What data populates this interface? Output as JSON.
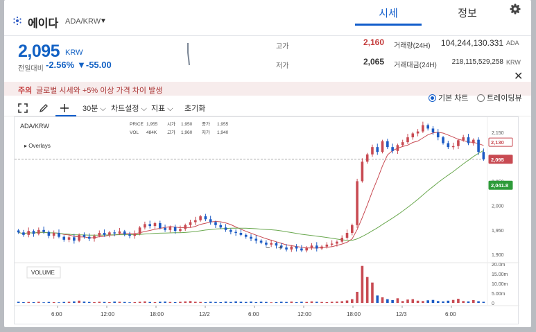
{
  "header": {
    "coin_name": "에이다",
    "pair": "ADA/KRW",
    "tabs": [
      {
        "label": "시세",
        "active": true
      },
      {
        "label": "정보",
        "active": false
      }
    ]
  },
  "price": {
    "current": "2,095",
    "unit": "KRW",
    "change_label": "전일대비",
    "change_rate": "-2.56%",
    "change_amount": "▼-55.00"
  },
  "stats": {
    "high_label": "고가",
    "high": "2,160",
    "low_label": "저가",
    "low": "2,065",
    "volume_label": "거래량(24H)",
    "volume": "104,244,130.331",
    "volume_unit": "ADA",
    "value_label": "거래대금(24H)",
    "value": "218,115,529,258",
    "value_unit": "KRW"
  },
  "notice": {
    "tag": "주의",
    "text": "글로벌 시세와 +5% 이상 가격 차이 발생"
  },
  "chart_mode": {
    "basic": "기본 차트",
    "tradingview": "트레이딩뷰",
    "selected": "basic"
  },
  "toolbar": {
    "interval": "30분",
    "settings": "차트설정",
    "indicators": "지표",
    "reset": "초기화"
  },
  "colors": {
    "up": "#c84a52",
    "down": "#1c5bc4",
    "ma_short": "#c84a52",
    "ma_long": "#6aa84f",
    "accent": "#115dcb"
  },
  "chart_data": {
    "type": "candlestick",
    "symbol": "ADA/KRW",
    "overlays_label": "Overlays",
    "info": {
      "price_label": "PRICE",
      "price": "1,955",
      "open_label": "시가",
      "open": "1,950",
      "close_label": "종가",
      "close": "1,955",
      "vol_label": "VOL",
      "vol": "484K",
      "high_label": "고가",
      "high": "1,960",
      "low_label": "저가",
      "low": "1,940"
    },
    "y_ticks": [
      "2,150",
      "2,100",
      "2,050",
      "2,000",
      "1,950",
      "1,900"
    ],
    "y_range": [
      1890,
      2170
    ],
    "x_ticks": [
      "6:00",
      "12:00",
      "18:00",
      "12/2",
      "6:00",
      "12:00",
      "18:00",
      "12/3",
      "6:00"
    ],
    "price_tags": [
      {
        "label": "2,130",
        "value": 2130,
        "color": "#c84a52",
        "style": "outline"
      },
      {
        "label": "2,095",
        "value": 2095,
        "color": "#c84a52",
        "style": "fill"
      },
      {
        "label": "2,041.8",
        "value": 2041.8,
        "color": "#2e9b3a",
        "style": "fill"
      }
    ],
    "volume_label": "VOLUME",
    "volume_ticks": [
      "20.0m",
      "15.00m",
      "10.00m",
      "5.00m",
      "0"
    ],
    "volume_max": 21,
    "closes": [
      1945,
      1940,
      1948,
      1942,
      1950,
      1946,
      1938,
      1944,
      1936,
      1930,
      1935,
      1928,
      1940,
      1936,
      1932,
      1938,
      1944,
      1940,
      1945,
      1943,
      1947,
      1941,
      1938,
      1942,
      1955,
      1962,
      1958,
      1964,
      1954,
      1950,
      1956,
      1948,
      1952,
      1960,
      1966,
      1970,
      1978,
      1972,
      1966,
      1960,
      1955,
      1950,
      1946,
      1944,
      1940,
      1936,
      1932,
      1928,
      1924,
      1920,
      1923,
      1918,
      1914,
      1910,
      1916,
      1912,
      1908,
      1914,
      1918,
      1912,
      1916,
      1920,
      1922,
      1926,
      1934,
      1944,
      1960,
      2050,
      2090,
      2105,
      2120,
      2110,
      2132,
      2120,
      2112,
      2124,
      2130,
      2140,
      2148,
      2152,
      2165,
      2158,
      2150,
      2140,
      2128,
      2120,
      2122,
      2134,
      2140,
      2128,
      2135,
      2110,
      2095
    ],
    "volumes": [
      0.6,
      0.4,
      0.5,
      0.4,
      0.6,
      0.3,
      0.5,
      0.4,
      0.3,
      0.5,
      0.6,
      0.8,
      1.2,
      0.7,
      0.5,
      0.4,
      0.6,
      0.5,
      0.4,
      0.7,
      0.6,
      0.5,
      0.3,
      0.4,
      0.6,
      0.8,
      0.5,
      0.4,
      0.6,
      0.7,
      0.5,
      0.4,
      0.6,
      0.8,
      1.0,
      0.6,
      0.5,
      0.4,
      0.6,
      0.5,
      0.4,
      0.7,
      0.5,
      0.8,
      0.6,
      0.5,
      0.7,
      0.4,
      0.6,
      0.5,
      0.3,
      0.4,
      0.6,
      0.5,
      0.7,
      0.4,
      0.6,
      0.5,
      0.8,
      0.6,
      0.5,
      0.4,
      0.6,
      0.7,
      0.9,
      1.3,
      2.0,
      6.0,
      20.0,
      14.0,
      11.0,
      4.0,
      3.0,
      2.0,
      1.5,
      2.5,
      1.0,
      1.8,
      2.0,
      1.2,
      1.0,
      1.4,
      1.6,
      1.0,
      0.8,
      1.2,
      1.6,
      2.2,
      1.0,
      0.8,
      1.5,
      0.9,
      0.6
    ]
  }
}
